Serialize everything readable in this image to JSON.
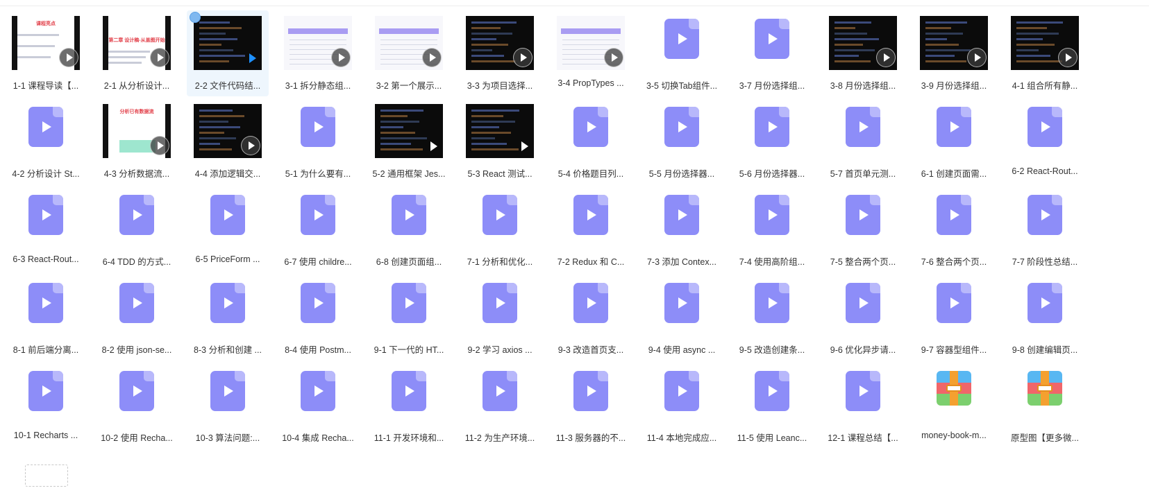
{
  "colors": {
    "file_icon": "#8d8df8",
    "file_icon_fold": "#b8b8fb",
    "selection_bg": "#eef6fd",
    "label_text": "#333333"
  },
  "files": [
    {
      "label": "1-1 课程导读【...",
      "kind": "thumb",
      "icon": "video-thumbnail",
      "thumb_title": "课程亮点",
      "play": "circle"
    },
    {
      "label": "2-1 从分析设计...",
      "kind": "thumb",
      "icon": "video-thumbnail",
      "thumb_title": "第二章 设计稿-从盖图开始",
      "play": "circle"
    },
    {
      "label": "2-2 文件代码结...",
      "kind": "thumb",
      "icon": "video-thumbnail",
      "play": "blue",
      "selected": true
    },
    {
      "label": "3-1 拆分静态组...",
      "kind": "thumb",
      "icon": "video-thumbnail",
      "play": "circle"
    },
    {
      "label": "3-2 第一个展示...",
      "kind": "thumb",
      "icon": "video-thumbnail",
      "play": "circle"
    },
    {
      "label": "3-3 为项目选择...",
      "kind": "thumb",
      "icon": "video-thumbnail",
      "play": "circle"
    },
    {
      "label": "3-4 PropTypes ...",
      "kind": "thumb",
      "icon": "video-thumbnail",
      "play": "circle"
    },
    {
      "label": "3-5 切换Tab组件...",
      "kind": "file",
      "icon": "video-file-icon"
    },
    {
      "label": "3-7 月份选择组...",
      "kind": "file",
      "icon": "video-file-icon"
    },
    {
      "label": "3-8 月份选择组...",
      "kind": "thumb",
      "icon": "video-thumbnail",
      "play": "circle"
    },
    {
      "label": "3-9 月份选择组...",
      "kind": "thumb",
      "icon": "video-thumbnail",
      "play": "circle"
    },
    {
      "label": "4-1 组合所有静...",
      "kind": "thumb",
      "icon": "video-thumbnail",
      "play": "circle"
    },
    {
      "label": "4-2 分析设计 St...",
      "kind": "file",
      "icon": "video-file-icon"
    },
    {
      "label": "4-3 分析数据流...",
      "kind": "thumb",
      "icon": "video-thumbnail",
      "thumb_title": "分析已有数据流",
      "play": "circle"
    },
    {
      "label": "4-4 添加逻辑交...",
      "kind": "thumb",
      "icon": "video-thumbnail",
      "play": "circle"
    },
    {
      "label": "5-1 为什么要有...",
      "kind": "file",
      "icon": "video-file-icon"
    },
    {
      "label": "5-2 通用框架 Jes...",
      "kind": "thumb",
      "icon": "video-thumbnail",
      "play": "tri"
    },
    {
      "label": "5-3 React 测试...",
      "kind": "thumb",
      "icon": "video-thumbnail",
      "play": "tri"
    },
    {
      "label": "5-4 价格题目列...",
      "kind": "file",
      "icon": "video-file-icon"
    },
    {
      "label": "5-5 月份选择器...",
      "kind": "file",
      "icon": "video-file-icon"
    },
    {
      "label": "5-6 月份选择器...",
      "kind": "file",
      "icon": "video-file-icon"
    },
    {
      "label": "5-7 首页单元测...",
      "kind": "file",
      "icon": "video-file-icon"
    },
    {
      "label": "6-1 创建页面需...",
      "kind": "file",
      "icon": "video-file-icon"
    },
    {
      "label": "6-2 React-Rout...",
      "kind": "file",
      "icon": "video-file-icon"
    },
    {
      "label": "6-3 React-Rout...",
      "kind": "file",
      "icon": "video-file-icon"
    },
    {
      "label": "6-4 TDD 的方式...",
      "kind": "file",
      "icon": "video-file-icon"
    },
    {
      "label": "6-5 PriceForm ...",
      "kind": "file",
      "icon": "video-file-icon"
    },
    {
      "label": "6-7 使用 childre...",
      "kind": "file",
      "icon": "video-file-icon"
    },
    {
      "label": "6-8 创建页面组...",
      "kind": "file",
      "icon": "video-file-icon"
    },
    {
      "label": "7-1 分析和优化...",
      "kind": "file",
      "icon": "video-file-icon"
    },
    {
      "label": "7-2 Redux 和  C...",
      "kind": "file",
      "icon": "video-file-icon"
    },
    {
      "label": "7-3 添加 Contex...",
      "kind": "file",
      "icon": "video-file-icon"
    },
    {
      "label": "7-4 使用高阶组...",
      "kind": "file",
      "icon": "video-file-icon"
    },
    {
      "label": "7-5 整合两个页...",
      "kind": "file",
      "icon": "video-file-icon"
    },
    {
      "label": "7-6 整合两个页...",
      "kind": "file",
      "icon": "video-file-icon"
    },
    {
      "label": "7-7 阶段性总结...",
      "kind": "file",
      "icon": "video-file-icon"
    },
    {
      "label": "8-1 前后端分离...",
      "kind": "file",
      "icon": "video-file-icon"
    },
    {
      "label": "8-2 使用 json-se...",
      "kind": "file",
      "icon": "video-file-icon"
    },
    {
      "label": "8-3 分析和创建 ...",
      "kind": "file",
      "icon": "video-file-icon"
    },
    {
      "label": "8-4 使用 Postm...",
      "kind": "file",
      "icon": "video-file-icon"
    },
    {
      "label": "9-1 下一代的 HT...",
      "kind": "file",
      "icon": "video-file-icon"
    },
    {
      "label": "9-2 学习 axios ...",
      "kind": "file",
      "icon": "video-file-icon"
    },
    {
      "label": "9-3 改造首页支...",
      "kind": "file",
      "icon": "video-file-icon"
    },
    {
      "label": "9-4 使用 async ...",
      "kind": "file",
      "icon": "video-file-icon"
    },
    {
      "label": "9-5 改造创建条...",
      "kind": "file",
      "icon": "video-file-icon"
    },
    {
      "label": "9-6 优化异步请...",
      "kind": "file",
      "icon": "video-file-icon"
    },
    {
      "label": "9-7 容器型组件...",
      "kind": "file",
      "icon": "video-file-icon"
    },
    {
      "label": "9-8 创建编辑页...",
      "kind": "file",
      "icon": "video-file-icon"
    },
    {
      "label": "10-1 Recharts ...",
      "kind": "file",
      "icon": "video-file-icon"
    },
    {
      "label": "10-2 使用 Recha...",
      "kind": "file",
      "icon": "video-file-icon"
    },
    {
      "label": "10-3 算法问题:...",
      "kind": "file",
      "icon": "video-file-icon"
    },
    {
      "label": "10-4 集成 Recha...",
      "kind": "file",
      "icon": "video-file-icon"
    },
    {
      "label": "11-1 开发环境和...",
      "kind": "file",
      "icon": "video-file-icon"
    },
    {
      "label": "11-2 为生产环境...",
      "kind": "file",
      "icon": "video-file-icon"
    },
    {
      "label": "11-3 服务器的不...",
      "kind": "file",
      "icon": "video-file-icon"
    },
    {
      "label": "11-4 本地完成应...",
      "kind": "file",
      "icon": "video-file-icon"
    },
    {
      "label": "11-5 使用 Leanc...",
      "kind": "file",
      "icon": "video-file-icon"
    },
    {
      "label": "12-1 课程总结【...",
      "kind": "file",
      "icon": "video-file-icon"
    },
    {
      "label": "money-book-m...",
      "kind": "zip",
      "icon": "archive-icon"
    },
    {
      "label": "原型图【更多微...",
      "kind": "zip",
      "icon": "archive-icon"
    }
  ]
}
